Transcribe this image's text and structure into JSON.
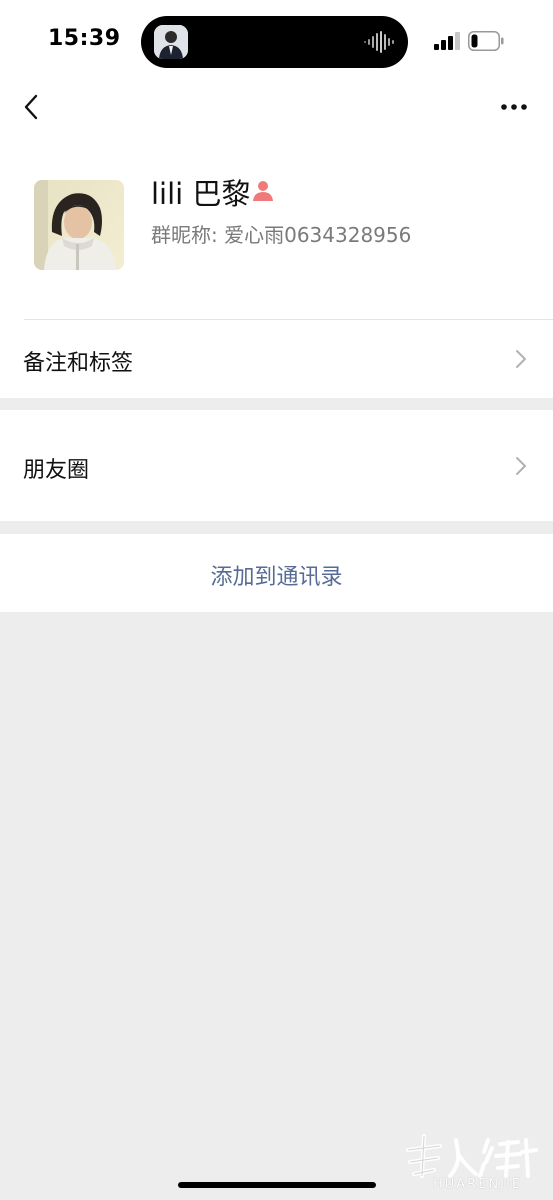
{
  "status_bar": {
    "time": "15:39"
  },
  "nav": {
    "back_icon": "chevron-left-icon",
    "more_icon": "more-dots-icon"
  },
  "profile": {
    "name": "lili 巴黎",
    "badge_icon": "person-badge-icon",
    "badge_color": "#f07a7a",
    "nickname_label": "群昵称: ",
    "nickname_value": "爱心雨0634328956"
  },
  "rows": {
    "remark_label": "备注和标签",
    "moments_label": "朋友圈",
    "add_contact_label": "添加到通讯录"
  },
  "watermark": {
    "text": "HUARENJIE"
  },
  "colors": {
    "link": "#576b95",
    "background": "#ededed",
    "secondary_text": "#7a7a7a"
  }
}
